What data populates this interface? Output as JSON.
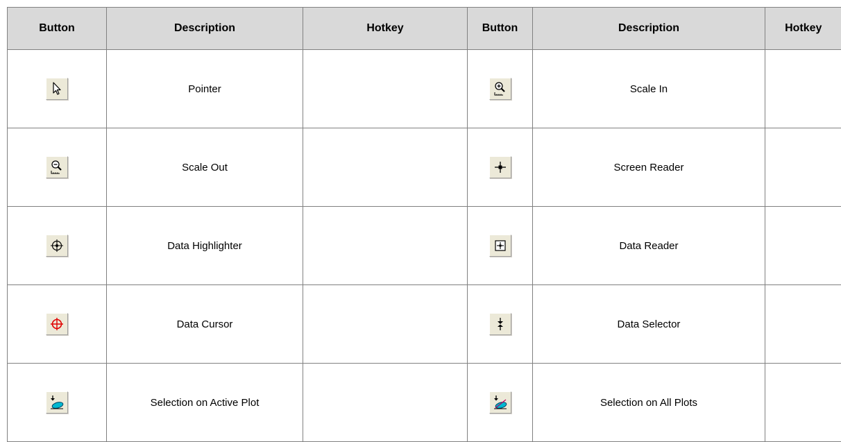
{
  "headers": [
    "Button",
    "Description",
    "Hotkey",
    "Button",
    "Description",
    "Hotkey"
  ],
  "rows": [
    {
      "left": {
        "icon": "pointer-icon",
        "description": "Pointer",
        "hotkey": ""
      },
      "right": {
        "icon": "scale-in-icon",
        "description": "Scale In",
        "hotkey": ""
      }
    },
    {
      "left": {
        "icon": "scale-out-icon",
        "description": "Scale Out",
        "hotkey": ""
      },
      "right": {
        "icon": "screen-reader-icon",
        "description": "Screen Reader",
        "hotkey": ""
      }
    },
    {
      "left": {
        "icon": "data-highlighter-icon",
        "description": "Data Highlighter",
        "hotkey": ""
      },
      "right": {
        "icon": "data-reader-icon",
        "description": "Data Reader",
        "hotkey": ""
      }
    },
    {
      "left": {
        "icon": "data-cursor-icon",
        "description": "Data Cursor",
        "hotkey": ""
      },
      "right": {
        "icon": "data-selector-icon",
        "description": "Data Selector",
        "hotkey": ""
      }
    },
    {
      "left": {
        "icon": "selection-on-active-plot-icon",
        "description": "Selection on Active Plot",
        "hotkey": ""
      },
      "right": {
        "icon": "selection-on-all-plots-icon",
        "description": "Selection on All Plots",
        "hotkey": ""
      }
    }
  ],
  "colors": {
    "header_bg": "#d9d9d9",
    "border": "#808080",
    "button_face": "#ece9d8",
    "cursor_red": "#e00000",
    "ellipse_cyan": "#00b8d0"
  }
}
